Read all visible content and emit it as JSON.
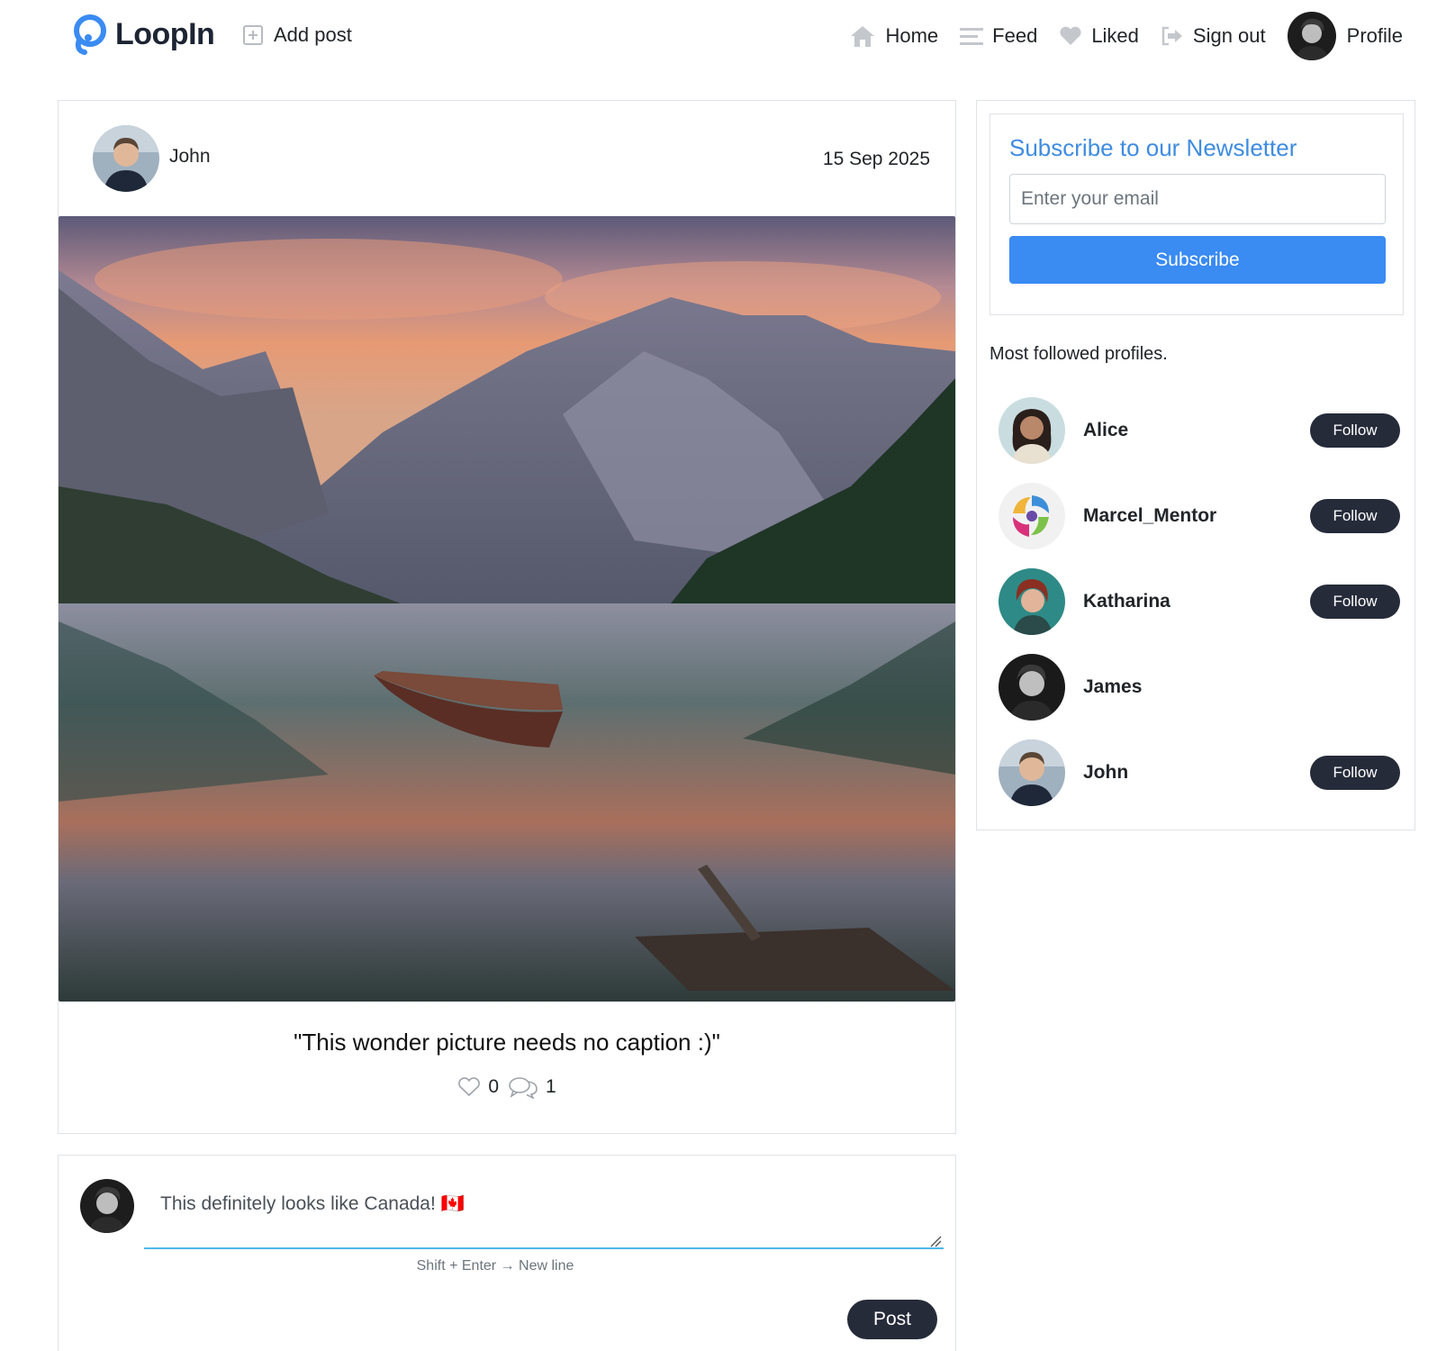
{
  "brand": {
    "name": "LoopIn",
    "logo_icon": "loop-logo-icon",
    "accent": "#3a8bf2"
  },
  "nav": {
    "add_post": "Add post",
    "home": "Home",
    "feed": "Feed",
    "liked": "Liked",
    "sign_out": "Sign out",
    "profile": "Profile"
  },
  "post": {
    "author": "John",
    "date": "15 Sep 2025",
    "image_alt": "Mountain lake at sunset with a wooden rowboat",
    "caption": "\"This wonder picture needs no caption :)\"",
    "likes": "0",
    "comments": "1"
  },
  "comment_box": {
    "value": "This definitely looks like Canada! 🇨🇦",
    "hint": "Shift + Enter → New line",
    "post_label": "Post"
  },
  "newsletter": {
    "title": "Subscribe to our Newsletter",
    "email_placeholder": "Enter your email",
    "subscribe_label": "Subscribe"
  },
  "sidebar": {
    "most_followed_label": "Most followed profiles.",
    "profiles": [
      {
        "name": "Alice",
        "follow_label": "Follow"
      },
      {
        "name": "Marcel_Mentor",
        "follow_label": "Follow"
      },
      {
        "name": "Katharina",
        "follow_label": "Follow"
      },
      {
        "name": "James",
        "follow_label": ""
      },
      {
        "name": "John",
        "follow_label": "Follow"
      }
    ]
  },
  "colors": {
    "button_dark": "#262b3a",
    "newsletter_title": "#3f8ce0",
    "subscribe_button": "#3a8bf2",
    "input_underline": "#4fb8e8"
  }
}
